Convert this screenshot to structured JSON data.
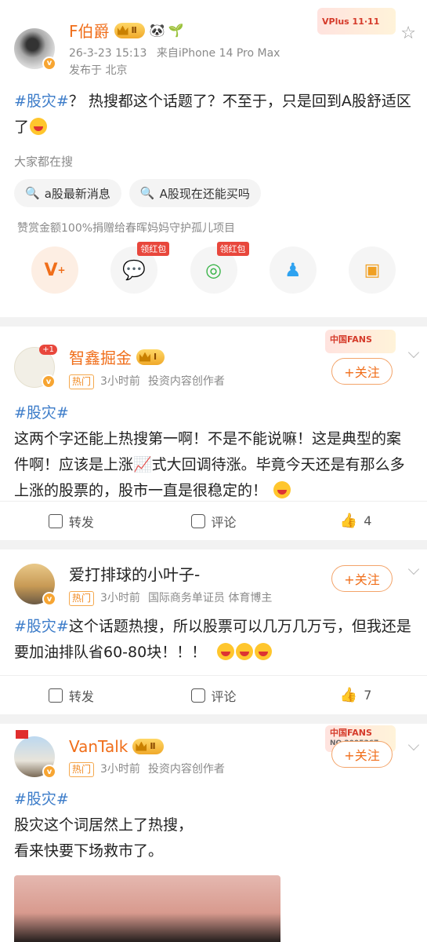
{
  "post1": {
    "username": "F伯爵",
    "level": "Ⅱ",
    "timestamp": "26-3-23 15:13",
    "source": "来自iPhone 14 Pro Max",
    "location": "发布于 北京",
    "vplus_banner": "VPlus 11·11",
    "tag": "#股灾#",
    "text": "？ 热搜都这个话题了？不至于，只是回到A股舒适区了",
    "search_title": "大家都在搜",
    "searches": [
      "a股最新消息",
      "A股现在还能买吗"
    ],
    "donation": "赞赏金额100%捐赠给春晖妈妈守护孤儿项目",
    "share_badge": "领红包"
  },
  "post2": {
    "username": "智鑫掘金",
    "level": "Ⅰ",
    "avatar_badge": "+1",
    "hot": "热门",
    "time": "3小时前",
    "desc": "投资内容创作者",
    "follow": "+关注",
    "fans_banner": "中国FANS",
    "tag": "#股灾#",
    "text": "这两个字还能上热搜第一啊！不是不能说嘛！这是典型的案件啊！应该是上涨📈式大回调待涨。毕竟今天还是有那么多上涨的股票的，股市一直是很稳定的！",
    "repost": "转发",
    "comment": "评论",
    "likes": "4"
  },
  "post3": {
    "username": "爱打排球的小叶子-",
    "hot": "热门",
    "time": "3小时前",
    "desc": "国际商务单证员 体育博主",
    "follow": "+关注",
    "tag": "#股灾#",
    "text": "这个话题热搜，所以股票可以几万几万亏，但我还是要加油排队省60-80块！！！",
    "repost": "转发",
    "comment": "评论",
    "likes": "7"
  },
  "post4": {
    "username": "VanTalk",
    "level": "Ⅱ",
    "hot": "热门",
    "time": "3小时前",
    "desc": "投资内容创作者",
    "follow": "+关注",
    "fans_banner": "中国FANS",
    "fans_no": "NO.2005367",
    "tag": "#股灾#",
    "line1": "股灾这个词居然上了热搜，",
    "line2": "看来快要下场救市了。"
  },
  "colors": {
    "accent": "#f06e1a",
    "link": "#3c7cc9"
  }
}
